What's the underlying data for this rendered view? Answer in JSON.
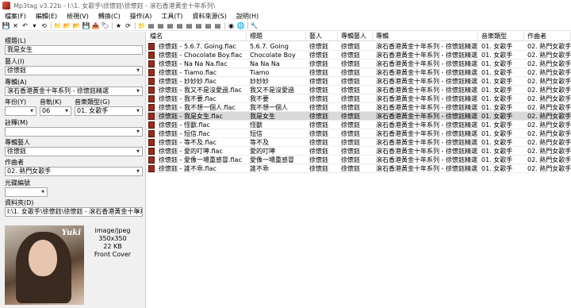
{
  "window": {
    "title": "Mp3tag v3.22b  -  I:\\1. 女歌手\\徐懷鈺\\徐懷鈺 - 滾石香港黃金十年系列\\"
  },
  "menu": [
    "檔案(F)",
    "編輯(E)",
    "檢視(V)",
    "轉換(C)",
    "操作(A)",
    "工具(T)",
    "資料來源(S)",
    "說明(H)"
  ],
  "toolbar": {
    "icons": [
      "save-icon",
      "remove-tag-icon",
      "undo-icon",
      "undo-dropdown-icon",
      "reload-icon",
      "change-dir-icon",
      "add-dir-icon",
      "favorite-dir-icon",
      "save-dir-icon",
      "export-icon",
      "tag-sources-icon",
      "star-icon",
      "refresh-icon",
      "open-folder-icon",
      "tag-to-filename-icon",
      "filename-to-tag-icon",
      "text-to-tag-icon",
      "rename-folder-icon",
      "format-icon",
      "actions-icon",
      "actions-quick-icon",
      "export-html-icon",
      "playlist-icon",
      "web-icon",
      "settings-icon"
    ],
    "glyphs": [
      "💾",
      "✕",
      "↶",
      "▾",
      "⟲",
      "📁",
      "📂",
      "📂",
      "💾",
      "📤",
      "🏷",
      "★",
      "⟳",
      "📁",
      "▤",
      "▤",
      "▤",
      "▤",
      "▤",
      "▤",
      "▤",
      "▤",
      "◉",
      "🌐",
      "🔧"
    ]
  },
  "panel": {
    "title_label": "標題(L)",
    "title_value": "我是女生",
    "artist_label": "藝人(I)",
    "artist_value": "徐懷鈺",
    "album_label": "專輯(A)",
    "album_value": "滾石香港黃金十年系列 - 徐懷鈺精選",
    "year_label": "年份(Y)",
    "year_value": "",
    "track_label": "音軌(K)",
    "track_value": "06",
    "genre_label": "音樂類型(G)",
    "genre_value": "01. 女歌手",
    "comment_label": "註釋(M)",
    "comment_value": "",
    "albumartist_label": "專輯藝人",
    "albumartist_value": "徐懷鈺",
    "composer_label": "作曲者",
    "composer_value": "02. 熱門女歌手",
    "discnumber_label": "光碟編號",
    "discnumber_value": "",
    "directory_label": "資料夾(D)",
    "directory_value": "I:\\1. 女歌手\\徐懷鈺\\徐懷鈺 - 滾石香港黃金十年系",
    "cover": {
      "brand": "Yuki",
      "mime": "image/jpeg",
      "dims": "350x350",
      "size": "22 KB",
      "type": "Front Cover"
    }
  },
  "grid": {
    "headers": [
      "檔名",
      "標題",
      "藝人",
      "專輯藝人",
      "專輯",
      "音樂類型",
      "作曲者"
    ],
    "rows": [
      [
        "徐懷鈺 - 5.6.7. Going.flac",
        "5.6.7. Going",
        "徐懷鈺",
        "徐懷鈺",
        "滾石香港黃金十年系列 - 徐懷鈺精選",
        "01. 女歌手",
        "02. 熱門女歌手"
      ],
      [
        "徐懷鈺 - Chocolate Boy.flac",
        "Chocolate Boy",
        "徐懷鈺",
        "徐懷鈺",
        "滾石香港黃金十年系列 - 徐懷鈺精選",
        "01. 女歌手",
        "02. 熱門女歌手"
      ],
      [
        "徐懷鈺 - Na Na Na.flac",
        "Na Na Na",
        "徐懷鈺",
        "徐懷鈺",
        "滾石香港黃金十年系列 - 徐懷鈺精選",
        "01. 女歌手",
        "02. 熱門女歌手"
      ],
      [
        "徐懷鈺 - Tiamo.flac",
        "Tiamo",
        "徐懷鈺",
        "徐懷鈺",
        "滾石香港黃金十年系列 - 徐懷鈺精選",
        "01. 女歌手",
        "02. 熱門女歌手"
      ],
      [
        "徐懷鈺 - 妙妙妙.flac",
        "妙妙妙",
        "徐懷鈺",
        "徐懷鈺",
        "滾石香港黃金十年系列 - 徐懷鈺精選",
        "01. 女歌手",
        "02. 熱門女歌手"
      ],
      [
        "徐懷鈺 - 我又不是沒愛過.flac",
        "我又不是沒愛過",
        "徐懷鈺",
        "徐懷鈺",
        "滾石香港黃金十年系列 - 徐懷鈺精選",
        "01. 女歌手",
        "02. 熱門女歌手"
      ],
      [
        "徐懷鈺 - 我不要.flac",
        "我不要",
        "徐懷鈺",
        "徐懷鈺",
        "滾石香港黃金十年系列 - 徐懷鈺精選",
        "01. 女歌手",
        "02. 熱門女歌手"
      ],
      [
        "徐懷鈺 - 我不想一個人.flac",
        "我不想一個人",
        "徐懷鈺",
        "徐懷鈺",
        "滾石香港黃金十年系列 - 徐懷鈺精選",
        "01. 女歌手",
        "02. 熱門女歌手"
      ],
      [
        "徐懷鈺 - 我是女生.flac",
        "我是女生",
        "徐懷鈺",
        "徐懷鈺",
        "滾石香港黃金十年系列 - 徐懷鈺精選",
        "01. 女歌手",
        "02. 熱門女歌手"
      ],
      [
        "徐懷鈺 - 怪獸.flac",
        "怪獸",
        "徐懷鈺",
        "徐懷鈺",
        "滾石香港黃金十年系列 - 徐懷鈺精選",
        "01. 女歌手",
        "02. 熱門女歌手"
      ],
      [
        "徐懷鈺 - 短信.flac",
        "短信",
        "徐懷鈺",
        "徐懷鈺",
        "滾石香港黃金十年系列 - 徐懷鈺精選",
        "01. 女歌手",
        "02. 熱門女歌手"
      ],
      [
        "徐懷鈺 - 等不及.flac",
        "等不及",
        "徐懷鈺",
        "徐懷鈺",
        "滾石香港黃金十年系列 - 徐懷鈺精選",
        "01. 女歌手",
        "02. 熱門女歌手"
      ],
      [
        "徐懷鈺 - 愛的叮嚀.flac",
        "愛的叮嚀",
        "徐懷鈺",
        "徐懷鈺",
        "滾石香港黃金十年系列 - 徐懷鈺精選",
        "01. 女歌手",
        "02. 熱門女歌手"
      ],
      [
        "徐懷鈺 - 愛像一場重感冒.flac",
        "愛像一場重感冒",
        "徐懷鈺",
        "徐懷鈺",
        "滾石香港黃金十年系列 - 徐懷鈺精選",
        "01. 女歌手",
        "02. 熱門女歌手"
      ],
      [
        "徐懷鈺 - 誰不乖.flac",
        "誰不乖",
        "徐懷鈺",
        "徐懷鈺",
        "滾石香港黃金十年系列 - 徐懷鈺精選",
        "01. 女歌手",
        "02. 熱門女歌手"
      ]
    ],
    "selected_row": 8
  }
}
